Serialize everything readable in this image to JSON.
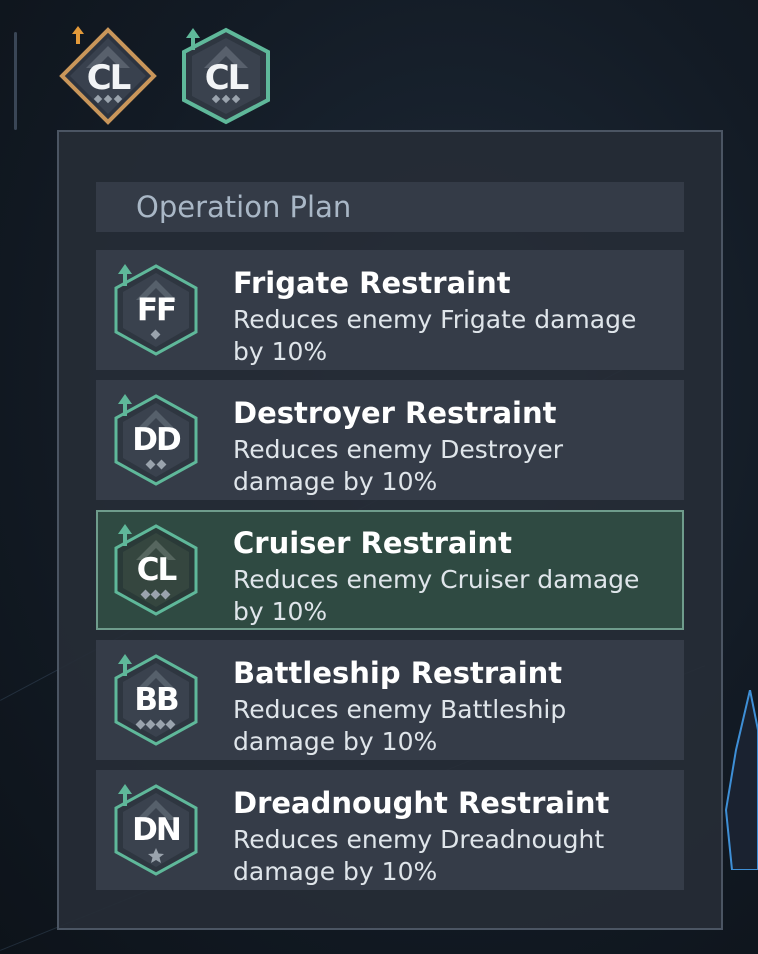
{
  "top_badges": [
    {
      "code": "CL",
      "style": "gold"
    },
    {
      "code": "CL",
      "style": "green"
    }
  ],
  "header": {
    "title": "Operation Plan"
  },
  "plans": [
    {
      "code": "FF",
      "name": "Frigate Restraint",
      "description": "Reduces enemy Frigate damage by 10%",
      "selected": false,
      "rank_icon": "1-diamond"
    },
    {
      "code": "DD",
      "name": "Destroyer Restraint",
      "description": "Reduces enemy Destroyer damage by 10%",
      "selected": false,
      "rank_icon": "2-diamonds"
    },
    {
      "code": "CL",
      "name": "Cruiser Restraint",
      "description": "Reduces enemy Cruiser damage by 10%",
      "selected": true,
      "rank_icon": "3-diamonds"
    },
    {
      "code": "BB",
      "name": "Battleship Restraint",
      "description": "Reduces enemy Battleship damage by 10%",
      "selected": false,
      "rank_icon": "4-diamonds"
    },
    {
      "code": "DN",
      "name": "Dreadnought Restraint",
      "description": "Reduces enemy Dreadnought damage by 10%",
      "selected": false,
      "rank_icon": "star"
    }
  ],
  "colors": {
    "accent_green": "#5fb89a",
    "gold": "#c9965a",
    "selected_bg": "#2f4a42"
  }
}
